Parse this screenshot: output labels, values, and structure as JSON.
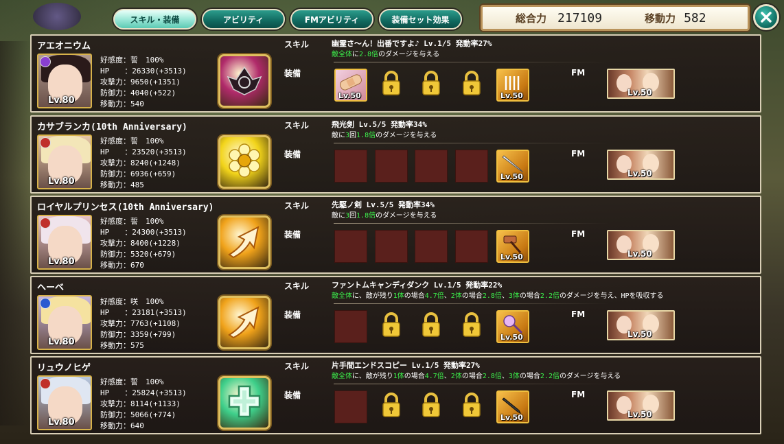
{
  "tabs": [
    {
      "label": "スキル・装備",
      "active": true
    },
    {
      "label": "アビリティ",
      "active": false
    },
    {
      "label": "FMアビリティ",
      "active": false
    },
    {
      "label": "装備セット効果",
      "active": false
    }
  ],
  "header": {
    "total_power_label": "総合力",
    "total_power": "217109",
    "move_label": "移動力",
    "move_value": "582"
  },
  "labels": {
    "skill": "スキル",
    "equip": "装備",
    "fm": "FM"
  },
  "units": [
    {
      "name": "アエオニウム",
      "level": "Lv.80",
      "element_color": "#8a3fd0",
      "hair_color": "#2a1a1a",
      "bg_color": "#b09a90",
      "stats": [
        "好感度：誓　100%",
        "HP　　：26330(+3513)",
        "攻撃力：9650(+1351)",
        "防御力：4040(+522)",
        "移動力：540"
      ],
      "skill_icon": "dark-wings-icon",
      "skill_icon_color": "#b02a6a",
      "skill_title": "幽霊さ～ん！出番ですよ♪ Lv.1/5 発動率27%",
      "skill_desc": [
        {
          "t": "敵全体",
          "g": true
        },
        {
          "t": "に",
          "g": false
        },
        {
          "t": "2.8倍",
          "g": true
        },
        {
          "t": "のダメージを与える",
          "g": false
        }
      ],
      "equip": [
        {
          "kind": "item",
          "variant": "pink",
          "icon": "bandage-icon",
          "level": "Lv.50"
        },
        {
          "kind": "locked"
        },
        {
          "kind": "locked"
        },
        {
          "kind": "locked"
        },
        {
          "kind": "item",
          "variant": "gold",
          "icon": "scroll-icon",
          "level": "Lv.50"
        }
      ],
      "fm_level": "Lv.50"
    },
    {
      "name": "カサブランカ(10th Anniversary)",
      "level": "Lv.80",
      "element_color": "#c0302a",
      "hair_color": "#f3e6b8",
      "bg_color": "#e6c7a8",
      "stats": [
        "好感度：誓　100%",
        "HP　　：23520(+3513)",
        "攻撃力：8240(+1248)",
        "防御力：6936(+659)",
        "移動力：485"
      ],
      "skill_icon": "flower-icon",
      "skill_icon_color": "#f2d41a",
      "skill_title": "飛光剣 Lv.5/5 発動率34%",
      "skill_desc": [
        {
          "t": "敵に",
          "g": false
        },
        {
          "t": "3",
          "g": true
        },
        {
          "t": "回",
          "g": false
        },
        {
          "t": "1.8倍",
          "g": true
        },
        {
          "t": "のダメージを与える",
          "g": false
        }
      ],
      "equip": [
        {
          "kind": "empty"
        },
        {
          "kind": "empty"
        },
        {
          "kind": "empty"
        },
        {
          "kind": "empty"
        },
        {
          "kind": "item",
          "variant": "gold",
          "icon": "sword-icon",
          "level": "Lv.50"
        }
      ],
      "fm_level": "Lv.50"
    },
    {
      "name": "ロイヤルプリンセス(10th Anniversary)",
      "level": "Lv.80",
      "element_color": "#c0302a",
      "hair_color": "#f0e4ec",
      "bg_color": "#e8c4c8",
      "stats": [
        "好感度：誓　100%",
        "HP　　：24300(+3513)",
        "攻撃力：8400(+1228)",
        "防御力：5320(+679)",
        "移動力：670"
      ],
      "skill_icon": "arrow-up-icon",
      "skill_icon_color": "#f0a21a",
      "skill_title": "先駆ノ剣 Lv.5/5 発動率34%",
      "skill_desc": [
        {
          "t": "敵に",
          "g": false
        },
        {
          "t": "3",
          "g": true
        },
        {
          "t": "回",
          "g": false
        },
        {
          "t": "1.8倍",
          "g": true
        },
        {
          "t": "のダメージを与える",
          "g": false
        }
      ],
      "equip": [
        {
          "kind": "empty"
        },
        {
          "kind": "empty"
        },
        {
          "kind": "empty"
        },
        {
          "kind": "empty"
        },
        {
          "kind": "item",
          "variant": "gold",
          "icon": "hammer-icon",
          "level": "Lv.50"
        }
      ],
      "fm_level": "Lv.50"
    },
    {
      "name": "ヘーベ",
      "level": "Lv.80",
      "element_color": "#2a5ad0",
      "hair_color": "#f5e2a0",
      "bg_color": "#c8b8e0",
      "stats": [
        "好感度：咲　100%",
        "HP　　：23181(+3513)",
        "攻撃力：7763(+1108)",
        "防御力：3359(+799)",
        "移動力：575"
      ],
      "skill_icon": "arrow-up-icon",
      "skill_icon_color": "#f0a21a",
      "skill_title": "ファントムキャンディダンク Lv.1/5 発動率22%",
      "skill_desc": [
        {
          "t": "敵全体",
          "g": true
        },
        {
          "t": "に、敵が残り",
          "g": false
        },
        {
          "t": "1体",
          "g": true
        },
        {
          "t": "の場合",
          "g": false
        },
        {
          "t": "4.7倍",
          "g": true
        },
        {
          "t": "、",
          "g": false
        },
        {
          "t": "2体",
          "g": true
        },
        {
          "t": "の場合",
          "g": false
        },
        {
          "t": "2.8倍",
          "g": true
        },
        {
          "t": "、",
          "g": false
        },
        {
          "t": "3体",
          "g": true
        },
        {
          "t": "の場合",
          "g": false
        },
        {
          "t": "2.2倍",
          "g": true
        },
        {
          "t": "のダメージを与え、HPを吸収する",
          "g": false
        }
      ],
      "equip": [
        {
          "kind": "empty"
        },
        {
          "kind": "locked"
        },
        {
          "kind": "locked"
        },
        {
          "kind": "locked"
        },
        {
          "kind": "item",
          "variant": "gold",
          "icon": "wand-icon",
          "level": "Lv.50"
        }
      ],
      "fm_level": "Lv.50"
    },
    {
      "name": "リュウノヒゲ",
      "level": "Lv.80",
      "element_color": "#c0302a",
      "hair_color": "#dfe6f2",
      "bg_color": "#b8c8e0",
      "stats": [
        "好感度：誓　100%",
        "HP　　：25824(+3513)",
        "攻撃力：8114(+1133)",
        "防御力：5066(+774)",
        "移動力：640"
      ],
      "skill_icon": "cross-icon",
      "skill_icon_color": "#3ecf8a",
      "skill_title": "片手間エンドスコピー Lv.1/5 発動率27%",
      "skill_desc": [
        {
          "t": "敵全体",
          "g": true
        },
        {
          "t": "に、敵が残り",
          "g": false
        },
        {
          "t": "1体",
          "g": true
        },
        {
          "t": "の場合",
          "g": false
        },
        {
          "t": "4.7倍",
          "g": true
        },
        {
          "t": "、",
          "g": false
        },
        {
          "t": "2体",
          "g": true
        },
        {
          "t": "の場合",
          "g": false
        },
        {
          "t": "2.8倍",
          "g": true
        },
        {
          "t": "、",
          "g": false
        },
        {
          "t": "3体",
          "g": true
        },
        {
          "t": "の場合",
          "g": false
        },
        {
          "t": "2.2倍",
          "g": true
        },
        {
          "t": "のダメージを与える",
          "g": false
        }
      ],
      "equip": [
        {
          "kind": "empty"
        },
        {
          "kind": "locked"
        },
        {
          "kind": "locked"
        },
        {
          "kind": "locked"
        },
        {
          "kind": "item",
          "variant": "gold",
          "icon": "dagger-icon",
          "level": "Lv.50"
        }
      ],
      "fm_level": "Lv.50"
    }
  ]
}
